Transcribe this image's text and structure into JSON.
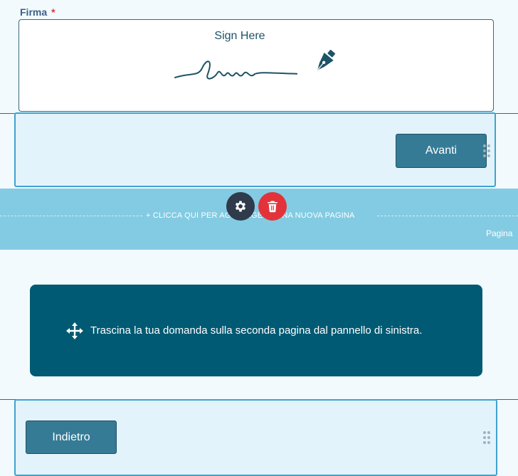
{
  "signature_field": {
    "label": "Firma",
    "required_mark": "*",
    "placeholder_text": "Sign Here",
    "icon": "pen-nib-icon"
  },
  "page1_nav": {
    "next_label": "Avanti",
    "drag_icon": "drag-handle-icon"
  },
  "page_break": {
    "add_page_label": "+ CLICCA QUI PER AGGIUNGERE UNA NUOVA PAGINA",
    "page_label": "Pagina",
    "settings_icon": "gear-icon",
    "delete_icon": "trash-icon"
  },
  "page2": {
    "drop_zone_text": "Trascina la tua domanda sulla seconda pagina dal pannello di sinistra.",
    "move_icon": "move-arrows-icon",
    "back_label": "Indietro"
  },
  "colors": {
    "accent": "#367b95",
    "band": "#83cbe2",
    "drop_zone": "#005a73",
    "delete": "#e2333b"
  }
}
